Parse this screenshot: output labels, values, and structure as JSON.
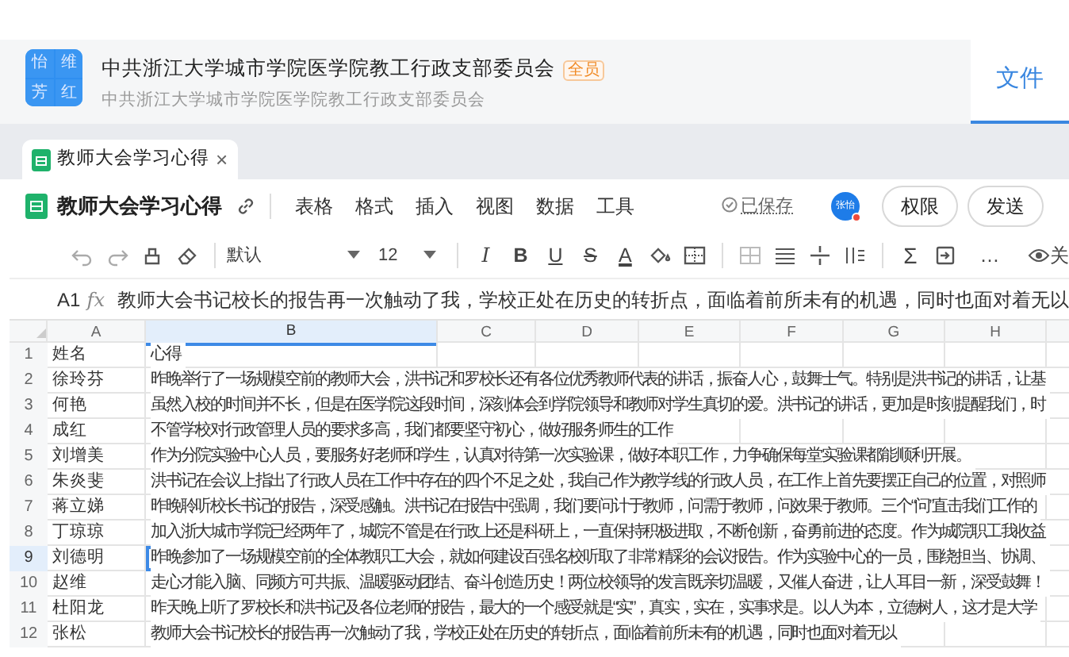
{
  "group": {
    "avatar_chars": [
      "怡",
      "维",
      "芳",
      "红"
    ],
    "title": "中共浙江大学城市学院医学院教工行政支部委员会",
    "badge": "全员",
    "subtitle": "中共浙江大学城市学院医学院教工行政支部委员会"
  },
  "side_tab": {
    "label": "文件",
    "selected": true
  },
  "doc_tabs": [
    {
      "label": "教师大会学习心得",
      "selected": true,
      "close": "×"
    }
  ],
  "doc": {
    "title": "教师大会学习心得",
    "menus": [
      "表格",
      "格式",
      "插入",
      "视图",
      "数据",
      "工具"
    ],
    "save_status": "已保存",
    "avatar_text": "张怡",
    "buttons": [
      "权限",
      "发送"
    ]
  },
  "toolbar": {
    "font": "默认",
    "size": "12",
    "glyphs": [
      "I",
      "B",
      "U",
      "S",
      "A",
      "Σ",
      "…"
    ],
    "view_label": "关"
  },
  "formula": {
    "cell": "A1",
    "fx": "fx",
    "text": "教师大会书记校长的报告再一次触动了我，学校正处在历史的转折点，面临着前所未有的机遇，同时也面对着无以"
  },
  "sheet": {
    "columns": [
      {
        "label": "A",
        "selected": false
      },
      {
        "label": "B",
        "selected": true
      },
      {
        "label": "C",
        "selected": false
      },
      {
        "label": "D",
        "selected": false
      },
      {
        "label": "E",
        "selected": false
      },
      {
        "label": "F",
        "selected": false
      },
      {
        "label": "G",
        "selected": false
      },
      {
        "label": "H",
        "selected": false
      }
    ],
    "rows": [
      {
        "number": "1",
        "name": "姓名",
        "text": "心得",
        "selected": false
      },
      {
        "number": "2",
        "name": "徐玲芬",
        "text": "昨晚举行了一场规模空前的教师大会，洪书记和罗校长还有各位优秀教师代表的讲话，振奋人心，鼓舞士气。特别是洪书记的讲话，让基",
        "selected": false
      },
      {
        "number": "3",
        "name": "何艳",
        "text": "虽然入校的时间并不长，但是在医学院这段时间，深刻体会到学院领导和教师对学生真切的爱。洪书记的讲话，更加是时刻提醒我们，时",
        "selected": false
      },
      {
        "number": "4",
        "name": "成红",
        "text": "不管学校对行政管理人员的要求多高，我们都要坚守初心，做好服务师生的工作",
        "selected": false
      },
      {
        "number": "5",
        "name": "刘增美",
        "text": "作为分院实验中心人员，要服务好老师和学生，认真对待第一次实验课，做好本职工作，力争确保每堂实验课都能顺利开展。",
        "selected": false
      },
      {
        "number": "6",
        "name": "朱炎斐",
        "text": "洪书记在会议上指出了行政人员在工作中存在的四个不足之处，我自己作为教学线的行政人员，在工作上首先要摆正自己的位置，对照师",
        "selected": false
      },
      {
        "number": "7",
        "name": "蒋立娣",
        "text": "昨晚聆听校长书记的报告，深受感触。洪书记在报告中强调，我们要问计于教师，问需于教师，问效果于教师。三个“问”直击我们工作的",
        "selected": false
      },
      {
        "number": "8",
        "name": "丁琼琼",
        "text": "加入浙大城市学院已经两年了，城院不管是在行政上还是科研上，一直保持积极进取，不断创新，奋勇前进的态度。作为城院职工我收益",
        "selected": false
      },
      {
        "number": "9",
        "name": "刘德明",
        "text": "昨晚参加了一场规模空前的全体教职工大会，就如何建设百强名校听取了非常精彩的会议报告。作为实验中心的一员，围绕担当、协调、",
        "selected": true
      },
      {
        "number": "10",
        "name": "赵维",
        "text": "走心才能入脑、同频方可共振、温暖驱动团结、奋斗创造历史！两位校领导的发言既亲切温暖，又催人奋进，让人耳目一新，深受鼓舞！",
        "selected": false
      },
      {
        "number": "11",
        "name": "杜阳龙",
        "text": "昨天晚上听了罗校长和洪书记及各位老师的报告，最大的一个感受就是“实”，真实，实在，实事求是。以人为本，立德树人，这才是大学",
        "selected": false
      },
      {
        "number": "12",
        "name": "张松",
        "text": "教师大会书记校长的报告再一次触动了我，学校正处在历史的转折点，面临着前所未有的机遇，同时也面对着无以",
        "selected": false
      }
    ]
  }
}
